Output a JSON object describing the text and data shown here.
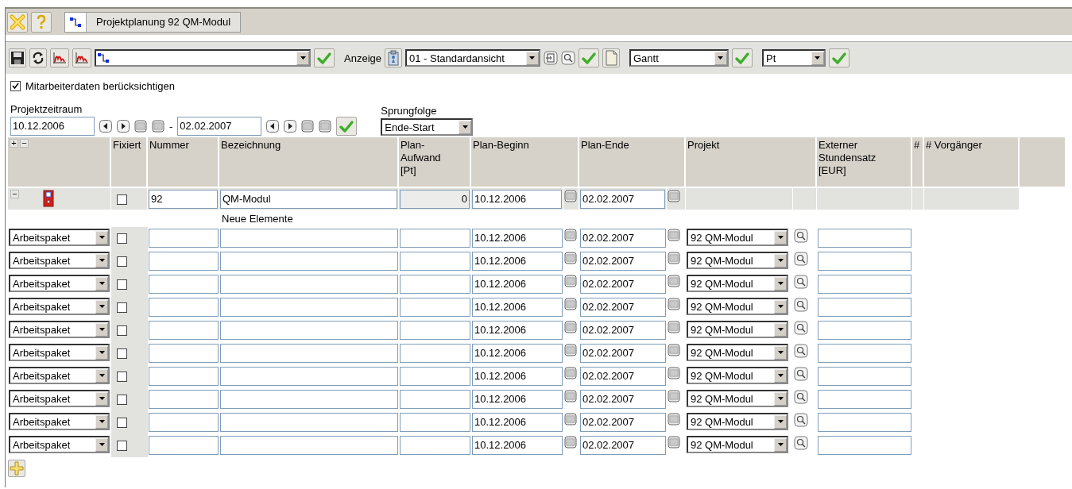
{
  "window": {
    "tab": "Projektplanung 92 QM-Modul"
  },
  "toolbar": {
    "view_label": "Anzeige",
    "view_select": {
      "value": "01 - Standardansicht"
    },
    "chart_select": {
      "value": "Gantt"
    },
    "unit_select": {
      "value": "Pt"
    }
  },
  "options": {
    "employee_data": {
      "label": "Mitarbeiterdaten berücksichtigen",
      "checked": true
    }
  },
  "period": {
    "label": "Projektzeitraum",
    "from": "10.12.2006",
    "separator": "-",
    "to": "02.02.2007"
  },
  "jump": {
    "label": "Sprungfolge",
    "value": "Ende-Start"
  },
  "table": {
    "expand": "+",
    "collapse": "−",
    "columns": [
      "Fixiert",
      "Nummer",
      "Bezeichnung",
      "Plan-\nAufwand\n[Pt]",
      "Plan-Beginn",
      "Plan-Ende",
      "Projekt",
      "Externer\nStundensatz\n[EUR]",
      "#",
      "# Vorgänger"
    ],
    "project_row": {
      "toggle": "−",
      "fixed": false,
      "number": "92",
      "name": "QM-Modul",
      "effort": "0",
      "begin": "10.12.2006",
      "end": "02.02.2007"
    },
    "section": "Neue Elemente",
    "rows": [
      {
        "type": "Arbeitspaket",
        "fixed": false,
        "begin": "10.12.2006",
        "end": "02.02.2007",
        "project": "92 QM-Modul"
      },
      {
        "type": "Arbeitspaket",
        "fixed": false,
        "begin": "10.12.2006",
        "end": "02.02.2007",
        "project": "92 QM-Modul"
      },
      {
        "type": "Arbeitspaket",
        "fixed": false,
        "begin": "10.12.2006",
        "end": "02.02.2007",
        "project": "92 QM-Modul"
      },
      {
        "type": "Arbeitspaket",
        "fixed": false,
        "begin": "10.12.2006",
        "end": "02.02.2007",
        "project": "92 QM-Modul"
      },
      {
        "type": "Arbeitspaket",
        "fixed": false,
        "begin": "10.12.2006",
        "end": "02.02.2007",
        "project": "92 QM-Modul"
      },
      {
        "type": "Arbeitspaket",
        "fixed": false,
        "begin": "10.12.2006",
        "end": "02.02.2007",
        "project": "92 QM-Modul"
      },
      {
        "type": "Arbeitspaket",
        "fixed": false,
        "begin": "10.12.2006",
        "end": "02.02.2007",
        "project": "92 QM-Modul"
      },
      {
        "type": "Arbeitspaket",
        "fixed": false,
        "begin": "10.12.2006",
        "end": "02.02.2007",
        "project": "92 QM-Modul"
      },
      {
        "type": "Arbeitspaket",
        "fixed": false,
        "begin": "10.12.2006",
        "end": "02.02.2007",
        "project": "92 QM-Modul"
      },
      {
        "type": "Arbeitspaket",
        "fixed": false,
        "begin": "10.12.2006",
        "end": "02.02.2007",
        "project": "92 QM-Modul"
      }
    ]
  }
}
